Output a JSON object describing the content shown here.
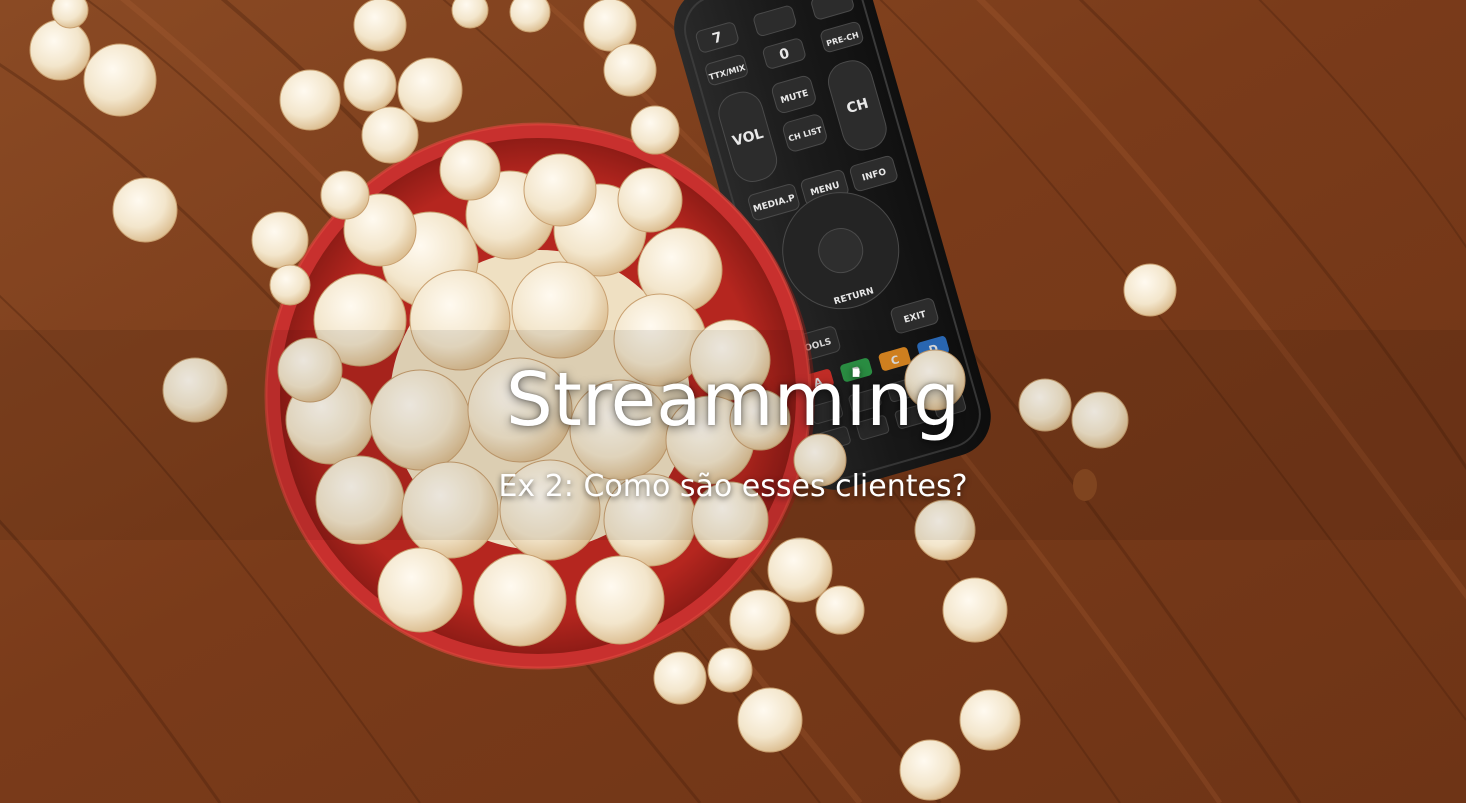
{
  "slide": {
    "title": "Streamming",
    "subtitle": "Ex 2: Como são esses clientes?"
  },
  "remote": {
    "labels": {
      "num7": "7",
      "num0": "0",
      "prech": "PRE-CH",
      "ttx": "TTX/MIX",
      "mute": "MUTE",
      "vol": "VOL",
      "ch": "CH",
      "chlist": "CH LIST",
      "media": "MEDIA.P",
      "menu": "MENU",
      "tools": "TOOLS",
      "info": "INFO",
      "return": "RETURN",
      "exit": "EXIT",
      "a": "A",
      "b": "B",
      "c": "C",
      "d": "D"
    }
  },
  "colors": {
    "wood_base": "#7a3d1c",
    "bowl_red": "#c8302e",
    "popcorn": "#f5ead6",
    "remote_body": "#1e1e1e",
    "button_a": "#d0302a",
    "button_b": "#2e9a48",
    "button_c": "#e08a22",
    "button_d": "#2d6fc0",
    "title_text": "#ffffff"
  }
}
